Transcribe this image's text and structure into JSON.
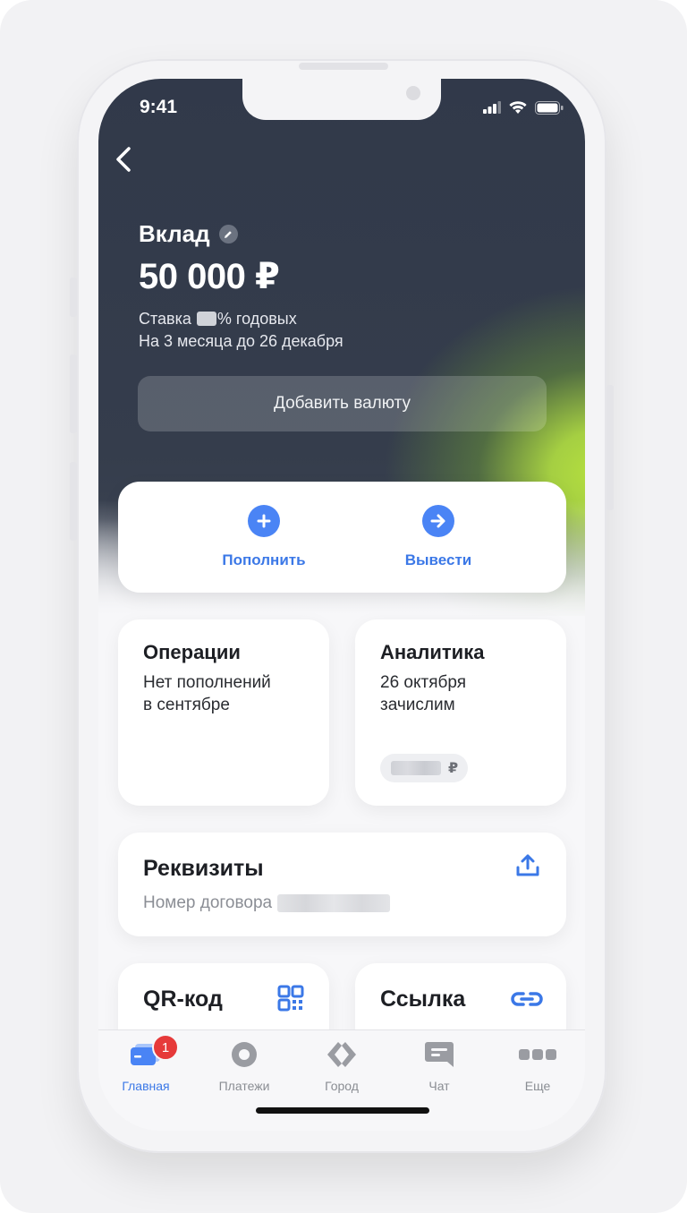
{
  "status_bar": {
    "time": "9:41"
  },
  "account": {
    "title": "Вклад",
    "amount": "50 000 ₽",
    "rate_prefix": "Ставка ",
    "rate_suffix": "% годовых",
    "term": "На 3 месяца до 26 декабря",
    "add_currency": "Добавить валюту"
  },
  "actions": {
    "topup": "Пополнить",
    "withdraw": "Вывести"
  },
  "tiles": {
    "operations": {
      "title": "Операции",
      "line1": "Нет пополнений",
      "line2": "в сентябре"
    },
    "analytics": {
      "title": "Аналитика",
      "line1": "26 октября",
      "line2": "зачислим",
      "currency": "₽"
    },
    "requisites": {
      "title": "Реквизиты",
      "subtitle": "Номер договора"
    },
    "qr": {
      "title": "QR-код"
    },
    "link": {
      "title": "Ссылка"
    }
  },
  "tabbar": [
    {
      "label": "Главная",
      "icon": "card-icon",
      "active": true,
      "badge": "1"
    },
    {
      "label": "Платежи",
      "icon": "payments-icon"
    },
    {
      "label": "Город",
      "icon": "city-icon"
    },
    {
      "label": "Чат",
      "icon": "chat-icon"
    },
    {
      "label": "Еще",
      "icon": "more-icon"
    }
  ],
  "colors": {
    "accent": "#3b78e7",
    "hero_dark": "#31394a",
    "hero_green": "#b5e03f",
    "badge": "#e63a3a"
  }
}
